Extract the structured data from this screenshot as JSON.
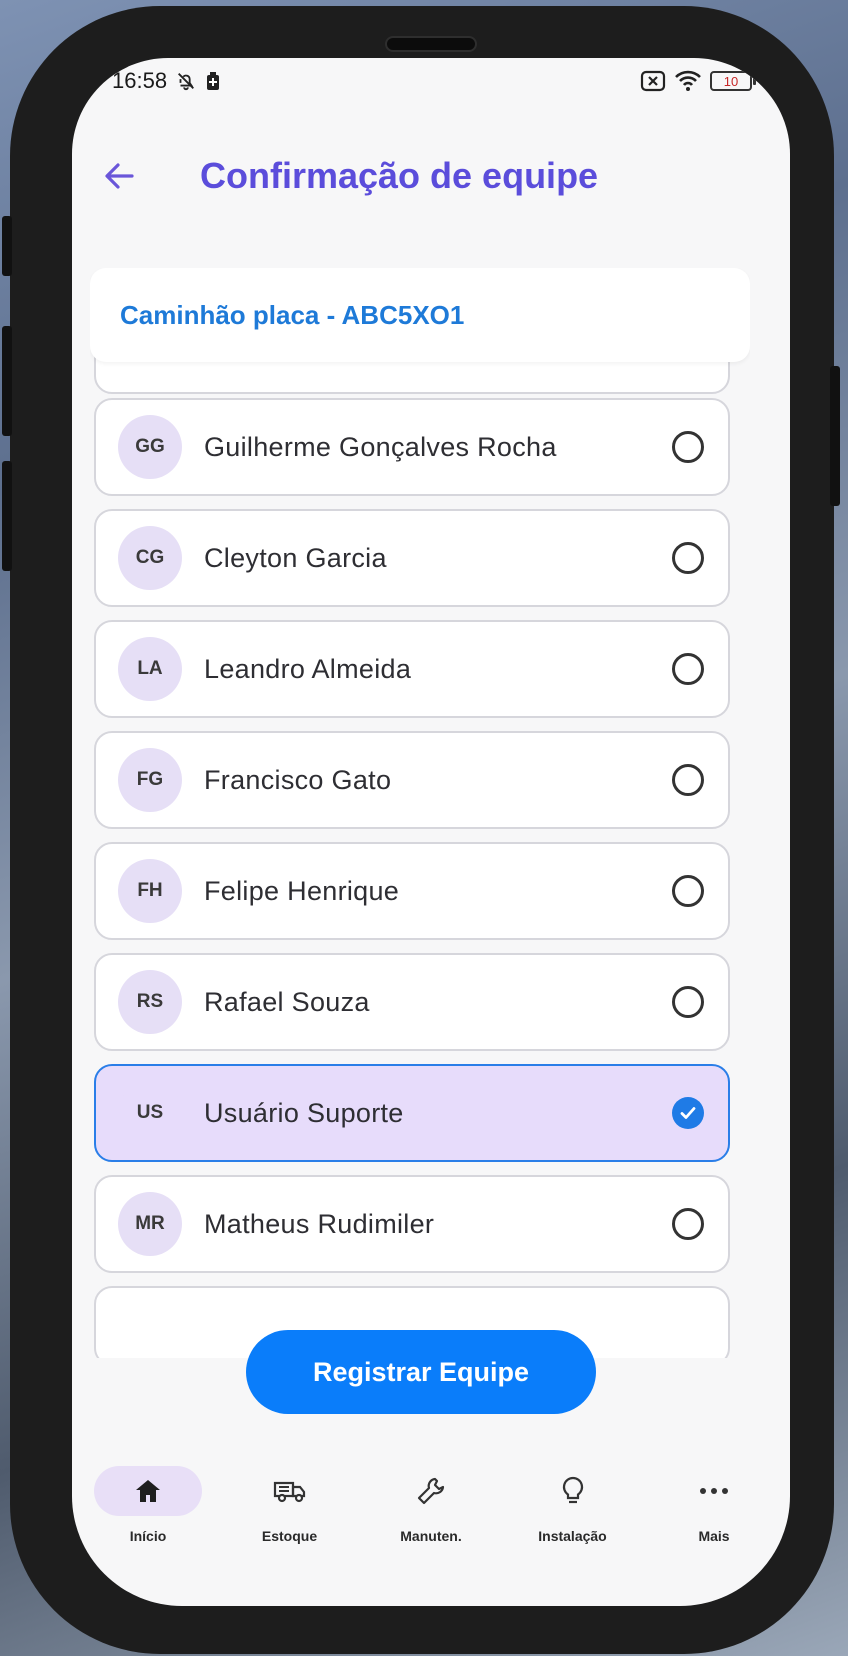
{
  "status_bar": {
    "time": "16:58",
    "battery_level": "10"
  },
  "header": {
    "title": "Confirmação de equipe"
  },
  "vehicle": {
    "label": "Caminhão placa - ABC5XO1"
  },
  "team_members": [
    {
      "initials": "GG",
      "name": "Guilherme Gonçalves Rocha",
      "selected": false
    },
    {
      "initials": "CG",
      "name": "Cleyton Garcia",
      "selected": false
    },
    {
      "initials": "LA",
      "name": "Leandro Almeida",
      "selected": false
    },
    {
      "initials": "FG",
      "name": "Francisco Gato",
      "selected": false
    },
    {
      "initials": "FH",
      "name": "Felipe Henrique",
      "selected": false
    },
    {
      "initials": "RS",
      "name": "Rafael Souza",
      "selected": false
    },
    {
      "initials": "US",
      "name": "Usuário Suporte",
      "selected": true
    },
    {
      "initials": "MR",
      "name": "Matheus Rudimiler",
      "selected": false
    }
  ],
  "actions": {
    "register_label": "Registrar Equipe"
  },
  "bottom_nav": {
    "items": [
      {
        "label": "Início",
        "icon": "home-icon",
        "active": true
      },
      {
        "label": "Estoque",
        "icon": "truck-icon",
        "active": false
      },
      {
        "label": "Manuten.",
        "icon": "wrench-icon",
        "active": false
      },
      {
        "label": "Instalação",
        "icon": "lightbulb-icon",
        "active": false
      },
      {
        "label": "Mais",
        "icon": "more-icon",
        "active": false
      }
    ]
  },
  "colors": {
    "accent": "#5b4ddb",
    "primary_button": "#0a7dfa",
    "selected_bg": "#e7dcfb",
    "vehicle_text": "#1e7ad8"
  }
}
